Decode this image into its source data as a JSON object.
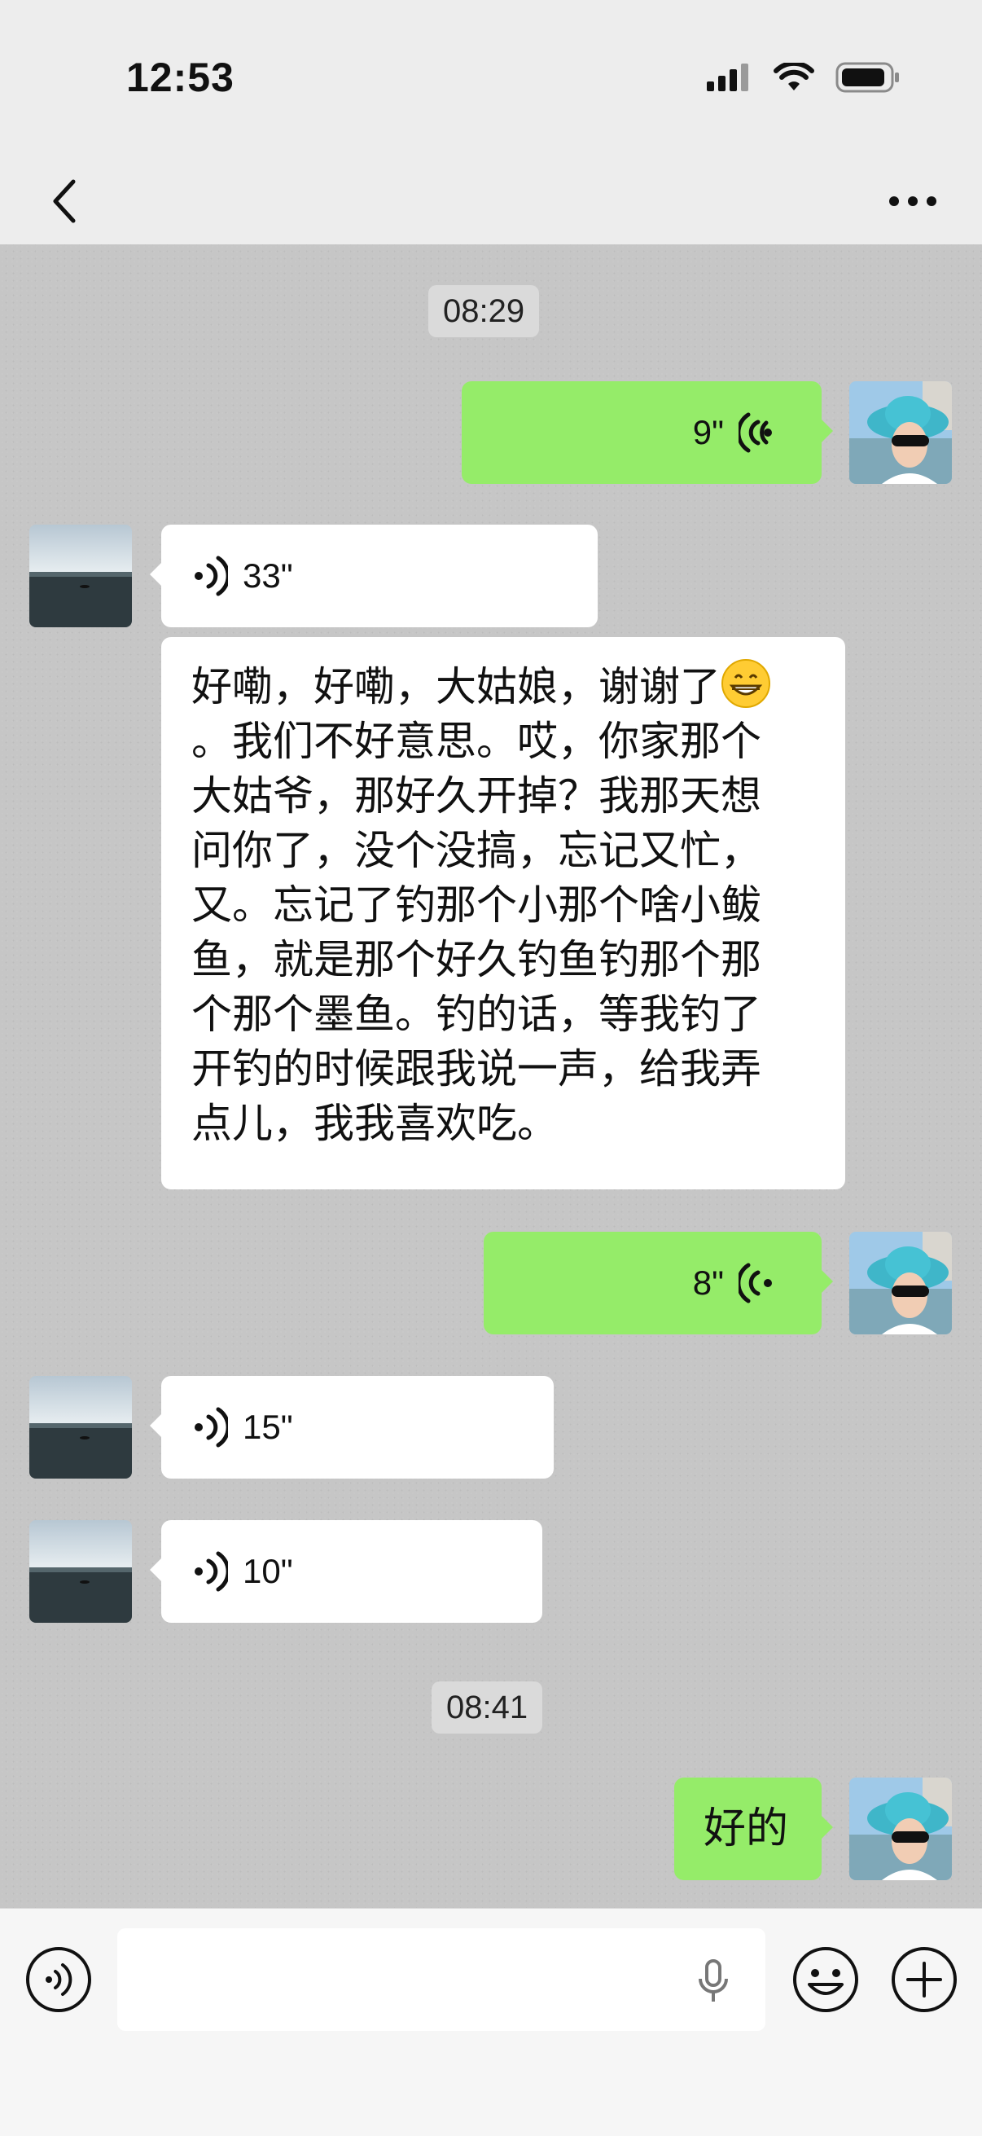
{
  "status_bar": {
    "time": "12:53"
  },
  "colors": {
    "out_bubble": "#95ec69",
    "in_bubble": "#ffffff",
    "chat_bg": "#c6c6c6",
    "bar_bg": "#ededed"
  },
  "nav": {
    "back_icon": "chevron-left-icon",
    "more_icon": "more-dots-icon"
  },
  "messages": [
    {
      "type": "timestamp",
      "text": "08:29"
    },
    {
      "type": "voice",
      "direction": "out",
      "duration": "9\""
    },
    {
      "type": "voice",
      "direction": "in",
      "duration": "33\""
    },
    {
      "type": "text",
      "direction": "in",
      "lines": [
        "好嘞，好嘞，大姑娘，谢谢了",
        "。我们不好意思。哎，你家那个",
        "大姑爷，那好久开掉？我那天想",
        "问你了，没个没搞，忘记又忙，",
        "又。忘记了钓那个小那个啥小鲅",
        "鱼，就是那个好久钓鱼钓那个那",
        "个那个墨鱼。钓的话，等我钓了",
        "开钓的时候跟我说一声，给我弄",
        "点儿，我我喜欢吃。"
      ],
      "emoji": "grinning-face-emoji"
    },
    {
      "type": "voice",
      "direction": "out",
      "duration": "8\""
    },
    {
      "type": "voice",
      "direction": "in",
      "duration": "15\""
    },
    {
      "type": "voice",
      "direction": "in",
      "duration": "10\""
    },
    {
      "type": "timestamp",
      "text": "08:41"
    },
    {
      "type": "text",
      "direction": "out",
      "text": "好的"
    }
  ],
  "input_bar": {
    "voice_toggle_icon": "voice-mode-icon",
    "mic_icon": "microphone-icon",
    "emoji_icon": "emoji-icon",
    "plus_icon": "plus-icon"
  }
}
